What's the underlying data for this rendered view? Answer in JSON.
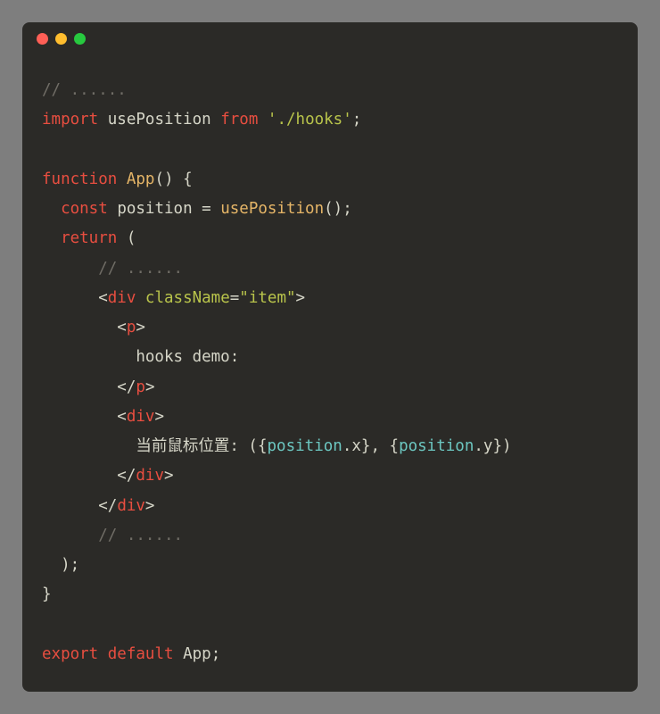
{
  "code": {
    "comment1": "// ......",
    "kw_import": "import",
    "import_name": "usePosition",
    "kw_from": "from",
    "import_path": "'./hooks'",
    "semi": ";",
    "kw_function": "function",
    "fn_name": "App",
    "parens_open": "(",
    "parens_close": ")",
    "brace_open": "{",
    "brace_close": "}",
    "kw_const": "const",
    "var_position": "position",
    "eq": " = ",
    "call_usePosition": "usePosition",
    "call_parens": "()",
    "kw_return": "return",
    "paren_open": "(",
    "paren_close": ")",
    "comment2": "// ......",
    "lt": "<",
    "gt": ">",
    "slash": "/",
    "tag_div": "div",
    "tag_p": "p",
    "attr_className": "className",
    "attr_eq": "=",
    "attr_val_item": "\"item\"",
    "text_hooks_demo": "hooks demo:",
    "text_mouse_pos": "当前鼠标位置: (",
    "text_comma": ", ",
    "text_close_paren": ")",
    "expr_lbrace": "{",
    "expr_rbrace": "}",
    "expr_obj": "position",
    "expr_dot": ".",
    "expr_x": "x",
    "expr_y": "y",
    "comment3": "// ......",
    "kw_export": "export",
    "kw_default": "default",
    "export_name": "App"
  }
}
